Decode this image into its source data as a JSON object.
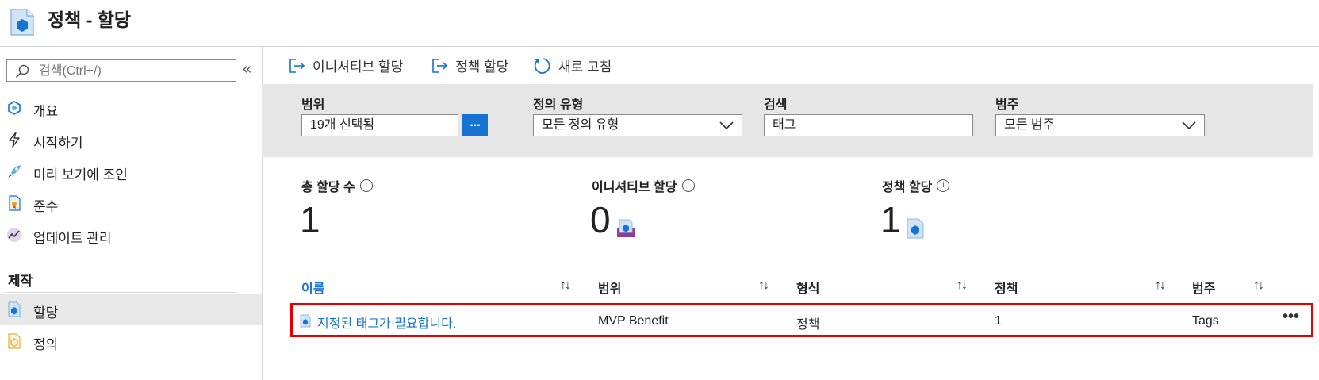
{
  "header": {
    "title": "정책 - 할당"
  },
  "sidebar": {
    "search_placeholder": "검색(Ctrl+/)",
    "collapse_icon": "«",
    "items": [
      {
        "label": "개요",
        "icon": "overview-icon"
      },
      {
        "label": "시작하기",
        "icon": "lightning-icon"
      },
      {
        "label": "미리 보기에 조인",
        "icon": "rocket-icon"
      },
      {
        "label": "준수",
        "icon": "compliance-icon"
      },
      {
        "label": "업데이트 관리",
        "icon": "chart-line-icon"
      }
    ],
    "section_label": "제작",
    "section_items": [
      {
        "label": "할당",
        "icon": "assignment-icon",
        "active": true
      },
      {
        "label": "정의",
        "icon": "definition-icon",
        "active": false
      }
    ]
  },
  "toolbar": {
    "assign_initiative": "이니셔티브 할당",
    "assign_policy": "정책 할당",
    "refresh": "새로 고침"
  },
  "filters": {
    "scope_label": "범위",
    "scope_value": "19개 선택됨",
    "scope_button": "...",
    "definition_type_label": "정의 유형",
    "definition_type_value": "모든 정의 유형",
    "search_label": "검색",
    "search_value": "태그",
    "category_label": "범주",
    "category_value": "모든 범주"
  },
  "summary": {
    "total_label": "총 할당 수",
    "total_value": "1",
    "initiative_label": "이니셔티브 할당",
    "initiative_value": "0",
    "policy_label": "정책 할당",
    "policy_value": "1",
    "info_glyph": "i"
  },
  "table": {
    "columns": [
      "이름",
      "범위",
      "형식",
      "정책",
      "범주"
    ],
    "sort_glyph": "↑↓",
    "rows": [
      {
        "name": "지정된 태그가 필요합니다.",
        "scope": "MVP Benefit",
        "type": "정책",
        "policies": "1",
        "category": "Tags",
        "more": "•••"
      }
    ]
  },
  "colors": {
    "accent": "#1673d3",
    "highlight": "#e20000",
    "filter_bg": "#e6e6e6"
  }
}
